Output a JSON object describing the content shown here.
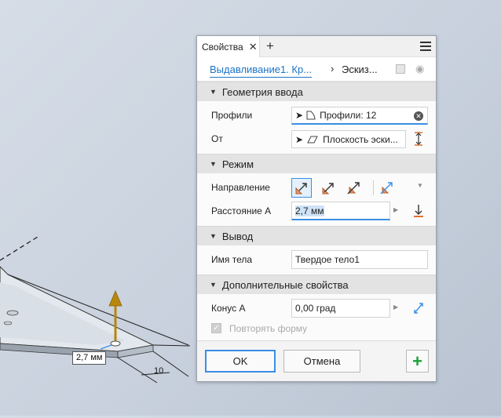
{
  "viewport": {
    "thickness_dim": "2,7 мм",
    "edge_dim": "10"
  },
  "panel": {
    "tab_label": "Свойства",
    "tab_close_icon": "close-icon",
    "tab_add_icon": "plus-icon",
    "breadcrumb_link": "Выдавливание1.  Кр...",
    "breadcrumb_sep": "›",
    "breadcrumb_current": "Эскиз...",
    "sections": {
      "input_geometry": {
        "title": "Геометрия ввода",
        "profiles_label": "Профили",
        "profiles_value": "Профили: 12",
        "from_label": "От",
        "from_value": "Плоскость эски..."
      },
      "mode": {
        "title": "Режим",
        "direction_label": "Направление",
        "distance_label": "Расстояние A",
        "distance_value": "2,7 мм"
      },
      "output": {
        "title": "Вывод",
        "body_name_label": "Имя тела",
        "body_name_value": "Твердое тело1"
      },
      "advanced": {
        "title": "Дополнительные свойства",
        "taper_label": "Конус A",
        "taper_value": "0,00 град",
        "repeat_shape_label": "Повторять форму"
      }
    },
    "buttons": {
      "ok": "OK",
      "cancel": "Отмена",
      "apply": "+"
    }
  },
  "colors": {
    "accent": "#3a8ee6",
    "link": "#1a73c8",
    "extrude_arrow": "#b8860b",
    "direction_icon": "#e89a6a",
    "apply_green": "#1aa33a"
  }
}
